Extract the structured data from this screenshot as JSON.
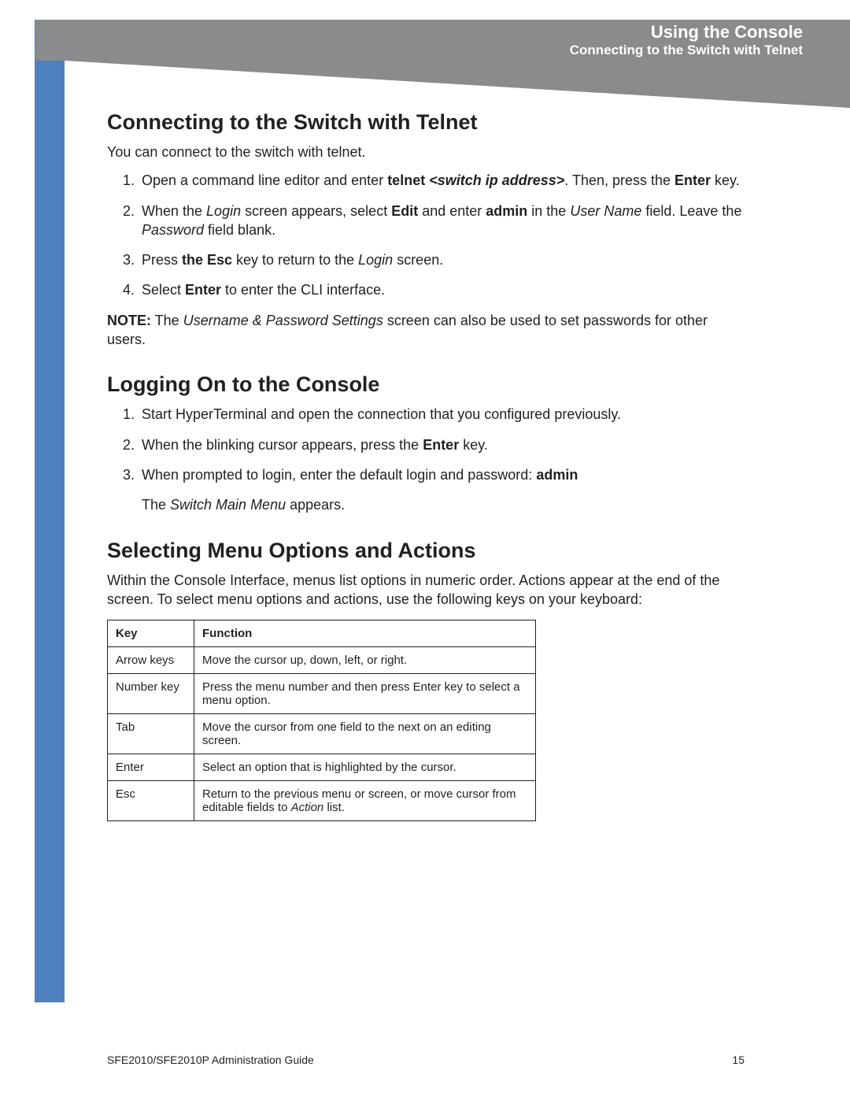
{
  "header": {
    "title": "Using the Console",
    "subtitle": "Connecting to the Switch with Telnet"
  },
  "section1": {
    "heading": "Connecting to the Switch with Telnet",
    "intro": "You can connect to the switch with telnet.",
    "step1_a": "Open a command line editor and enter ",
    "step1_b": "telnet",
    "step1_c": " <switch ip address>",
    "step1_d": ". Then, press the ",
    "step1_e": "Enter",
    "step1_f": " key.",
    "step2_a": "When the ",
    "step2_b": "Login",
    "step2_c": " screen appears, select ",
    "step2_d": "Edit",
    "step2_e": " and enter ",
    "step2_f": "admin",
    "step2_g": " in the ",
    "step2_h": "User Name",
    "step2_i": " field. Leave the ",
    "step2_j": "Password",
    "step2_k": " field blank.",
    "step3_a": "Press ",
    "step3_b": "the Esc",
    "step3_c": " key to return to the ",
    "step3_d": "Login",
    "step3_e": " screen.",
    "step4_a": "Select ",
    "step4_b": "Enter",
    "step4_c": " to enter the CLI interface.",
    "note_a": "NOTE:",
    "note_b": " The ",
    "note_c": "Username & Password Settings",
    "note_d": " screen can also be used to set passwords for other users."
  },
  "section2": {
    "heading": "Logging On to the Console",
    "step1": "Start HyperTerminal and open the connection that you configured previously.",
    "step2_a": "When the blinking cursor appears, press the ",
    "step2_b": "Enter",
    "step2_c": " key.",
    "step3_a": "When prompted to login, enter the default login and password: ",
    "step3_b": "admin",
    "result_a": "The ",
    "result_b": "Switch Main Menu",
    "result_c": " appears."
  },
  "section3": {
    "heading": "Selecting Menu Options and Actions",
    "intro": "Within the Console Interface, menus list options in numeric order. Actions appear at the end of the screen. To select menu options and actions, use the following keys on your keyboard:",
    "table": {
      "head_key": "Key",
      "head_func": "Function",
      "rows": [
        {
          "key": "Arrow keys",
          "func": "Move the cursor up, down, left, or right."
        },
        {
          "key": "Number key",
          "func": "Press the menu number and then press Enter key to select a menu option."
        },
        {
          "key": "Tab",
          "func": "Move the cursor from one field to the next on an editing screen."
        },
        {
          "key": "Enter",
          "func": "Select an option that is highlighted by the cursor."
        }
      ],
      "row_esc_key": "Esc",
      "row_esc_a": "Return to the previous menu or screen, or move cursor from editable fields to ",
      "row_esc_b": "Action",
      "row_esc_c": " list."
    }
  },
  "footer": {
    "doc": "SFE2010/SFE2010P Administration Guide",
    "page": "15"
  }
}
